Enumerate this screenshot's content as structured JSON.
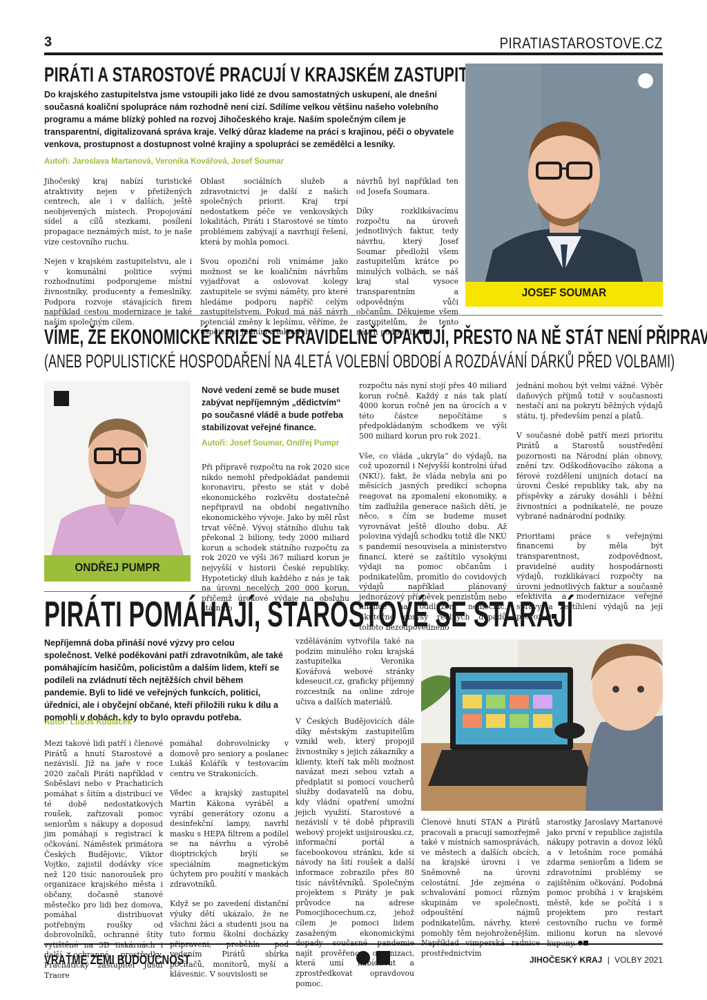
{
  "header": {
    "page_number": "3",
    "site": "PIRATIASTAROSTOVE.CZ"
  },
  "article1": {
    "title": "Piráti a Starostové pracují v krajském zastupitelstvu",
    "lead": "Do krajského zastupitelstva jsme vstoupili jako lidé ze dvou samostatných uskupení, ale dnešní současná koaliční spolupráce nám rozhodně není cizí. Sdílíme velkou většinu našeho volebního programu a máme blízký pohled na rozvoj Jihočeského kraje. Naším společným cílem je transparentní, digitalizovaná správa kraje. Velký důraz klademe na práci s krajinou, péči o obyvatele venkova, prostupnost a dostupnost volné krajiny a spolupráci se zemědělci a lesníky.",
    "authors": "Autoři: Jaroslava Martanová, Veronika Kovářová, Josef Soumar",
    "col1": [
      "Jihočeský kraj nabízí turistické atraktivity nejen v přetížených centrech, ale i v dalších, ještě neobjevených místech. Propojování sídel a cílů stezkami, posílení propagace neznámých míst, to je naše vize cestovního ruchu.",
      "Nejen v krajském zastupitelstvu, ale i v komunální politice svými rozhodnutími podporujeme místní živnostníky, producenty a řemeslníky. Podpora rozvoje stávajících firem například cestou modernizace je také naším společným cílem."
    ],
    "col2": [
      "Oblast sociálních služeb a zdravotnictví je další z našich společných priorit. Kraj trpí nedostatkem péče ve venkovských lokalitách, Piráti i Starostové se tímto problémem zabývají a navrhují řešení, která by mohla pomoci.",
      "Svou opoziční roli vnímáme jako možnost se ke koaličním návrhům vyjadřovat a oslovovat kolegy zastupitele se svými náměty, pro které hledáme podporu napříč celým zastupitelstvem. Pokud má náš návrh potenciál změny k lepšímu, věříme, že uspějeme. Jedním z takových"
    ],
    "col3": [
      "návrhů byl například ten od Josefa Soumara.",
      "Díky rozklikávacímu rozpočtu na úroveň jednotlivých faktur, tedy návrhu, který Josef Soumar předložil všem zastupitelům krátce po minulých volbách, se náš kraj stal vysoce transparentním a odpovědným vůči občanům. Děkujeme všem zastupitelům, že tento návrh podpořili."
    ],
    "photo_name": "JOSEF SOUMAR"
  },
  "article2": {
    "title": "Víme, že ekonomické krize se pravidelně opakují, přesto na ně stát není připraven",
    "subtitle": "(aneb populistické hospodaření na 4letá volební období a rozdávání dárků před volbami)",
    "lead": "Nové vedení země se bude muset zabývat nepříjemným „dědictvím“ po současné vládě a bude potřeba stabilizovat veřejné finance.",
    "authors": "Autoři: Josef Soumar, Ondřej Pumpr",
    "col1": [
      "Při přípravě rozpočtu na rok 2020 sice nikdo nemohl předpokládat pandemii koronaviru, přesto se stát v době ekonomického rozkvětu dostatečně nepřipravil na období negativního ekonomického vývoje. Jako by měl růst trvat věčně. Vývoj státního dluhu tak překonal 2 biliony, tedy 2000 miliard korun a schodek státního rozpočtu za rok 2020 ve výši 367 miliard korun je nejvyšší v historii České republiky. Hypotetický dluh každého z nás je tak na úrovni necelých 200 000 korun, přičemž úrokové výdaje na obsluhu státního"
    ],
    "col2": [
      "rozpočtu nás nyní stojí přes 40 miliard korun ročně. Každý z nás tak platí 4000 korun ročně jen na úrocích a v této částce nepočítáme s předpokládaným schodkem ve výši 500 miliard korun pro rok 2021.",
      "Vše, co vláda „ukryla“ do výdajů, na což upozornil i Nejvyšší kontrolní úřad (NKÚ), fakt, že vláda nebyla ani po měsících jasných predikcí schopna reagovat na zpomalení ekonomiky, a tím zadlužila generace našich dětí, je něco, s čím se budeme muset vyrovnávat ještě dlouho dobu. Až polovina výdajů schodku totiž dle NKÚ s pandemií nesouvisela a ministerstvo financí, které se zaštítilo vysokými výdaji na pomoc občanům i podnikatelům, promítlo do covidových výdajů například plánovaný jednorázový příspěvek penzistům nebo finance na oddlužení nemocnic. Skutečné obrysy reálných dopadů tohoto nezodpovědného"
    ],
    "col3": [
      "jednání mohou být velmi vážné. Výběr daňových příjmů totiž v současnosti nestačí ani na pokrytí běžných výdajů státu, tj. především penzí a platů.",
      "V současné době patří mezi prioritu Pirátů a Starostů soustředění pozornosti na Národní plán obnovy, znění tzv. Odškodňovacího zákona a férové rozdělení unijních dotací na úrovni České republiky tak, aby na příspěvky a záruky dosáhli i běžní živnostníci a podnikatelé, ne pouze vybrané nadnárodní podniky.",
      "Prioritami práce s veřejnými financemi by měla být transparentnost, zodpovědnost, pravidelné audity hospodárnosti výdajů, rozklikávací rozpočty na úrovni jednotlivých faktur a současně efektivita a modernizace veřejné správy a zeštíhlení výdajů na její provoz."
    ],
    "photo_name": "ONDŘEJ PUMPR"
  },
  "article3": {
    "title": "Piráti pomáhají, starostové se starají",
    "lead": "Nepříjemná doba přináší nové výzvy pro celou společnost. Velké poděkování patří zdravotníkům, ale také pomáhajícím hasičům, policistům a dalším lidem, kteří se podíleli na zvládnutí těch nejtěžších chvil během pandemie. Byli to lidé ve veřejných funkcích, politici, úředníci, ale i obyčejní občané, kteří přiložili ruku k dílu a pomohli v dobách, kdy to bylo opravdu potřeba.",
    "authors": "Autor: Luboš Kudláček",
    "col1": [
      "Mezi takové lidi patří i členové Pirátů a hnutí Starostové a nezávislí. Již na jaře v roce 2020 začali Piráti například v Soběslavi nebo v Prachaticích pomáhat s šitím a distribucí ve té době nedostatkových roušek, zařizovali pomoc seniorům s nákupy a doposud jim pomáhají s registrací k očkování. Náměstek primátora Českých Budějovic, Viktor Vojtko, zajistil dodávky více než 120 tisíc nanoroušek pro organizace krajského města i občany, dočasně stanové městečko pro lidi bez domova, pomáhal distribuovat potřebným roušky od dobrovolníků, ochranné štíty vytištěné na 3D tiskárnách i další ochranné prostředky. Prachatický zastupitel Jusuf Traore"
    ],
    "col2": [
      "pomáhal dobrovolnicky v domově pro seniory a poslanec Lukáš Kolářík v testovacím centru ve Strakonicích.",
      "Vědec a krajský zastupitel Martin Kákona vyráběl a vyrábí generátory ozonu a desinfekční lampy, navrhl masku s HEPA filtrem a podílel se na návrhu a výrobě dioptrických brýlí se speciálním magnetickým úchytem pro použití v maskách zdravotníků.",
      "Když se po zavedení distanční výuky dětí ukázalo, že ne všichni žáci a studenti jsou na tuto formu školní docházky připraveni, proběhla pod vedením Pirátů sbírka počítačů, monitorů, myší a klávesnic. V souvislosti se"
    ],
    "col3a": [
      "vzděláváním vytvořila také na podzim minulého roku krajská zastupitelka Veronika Kovářová webové stránky kdeseucit.cz, graficky příjemný rozcestník na online zdroje učiva a dalších materiálů.",
      "V Českých Budějovicích dále díky městským zastupitelům vznikl web, který propojil živnostníky s jejich zákazníky a klienty, kteří tak měli možnost navázat mezi sebou vztah a předplatit si pomocí voucherů služby dodavatelů na dobu, kdy vládní opatření umožní jejich využití. Starostové a nezávislí v té době připravili webový projekt usijsirousku.cz, informační portál a facebookovou stránku, kde si návody na šití roušek a další informace zobrazilo přes 80 tisíc návštěvníků. Společným projektem s Piráty je pak průvodce na adrese Pomocjihocechum.cz, jehož cílem je pomoci lidem zasaženým ekonomickými dopady současné pandemie najít prověřenou organizaci, která umí nabídnout a zprostředkovat opravdovou pomoc."
    ],
    "col3b": [
      "Členové hnutí STAN a Pirátů pracovali a pracují samozřejmě také v místních samosprávách, ve městech a dalších obcích, na krajské úrovni i ve Sněmovně na úrovni celostátní. Jde zejména o schvalování pomoci různým skupinám ve společnosti, odpouštění nájmů podnikatelům, návrhy, které pomohly těm nejohroženějším. Například vimperská radnice prostřednictvím"
    ],
    "col3c": [
      "starostky Jaroslavy Martanové jako první v republice zajistila nákupy potravin a dovoz léků a v letošním roce pomáhá zdarma seniorům a lidem se zdravotními problémy se zajištěním očkování. Podobná pomoc probíhá i v krajském městě, kde se počítá i s projektem pro restart cestovního ruchu ve formě milionu korun na slevové kupony."
    ]
  },
  "footer": {
    "slogan": "VRAŤME ZEMI BUDOUCNOST",
    "region": "JIHOČESKÝ KRAJ",
    "separator": "|",
    "election": "VOLBY 2021"
  },
  "colors": {
    "accent_yellow": "#f5e500",
    "accent_green": "#9bbf3a",
    "ink": "#1a1a1a"
  }
}
